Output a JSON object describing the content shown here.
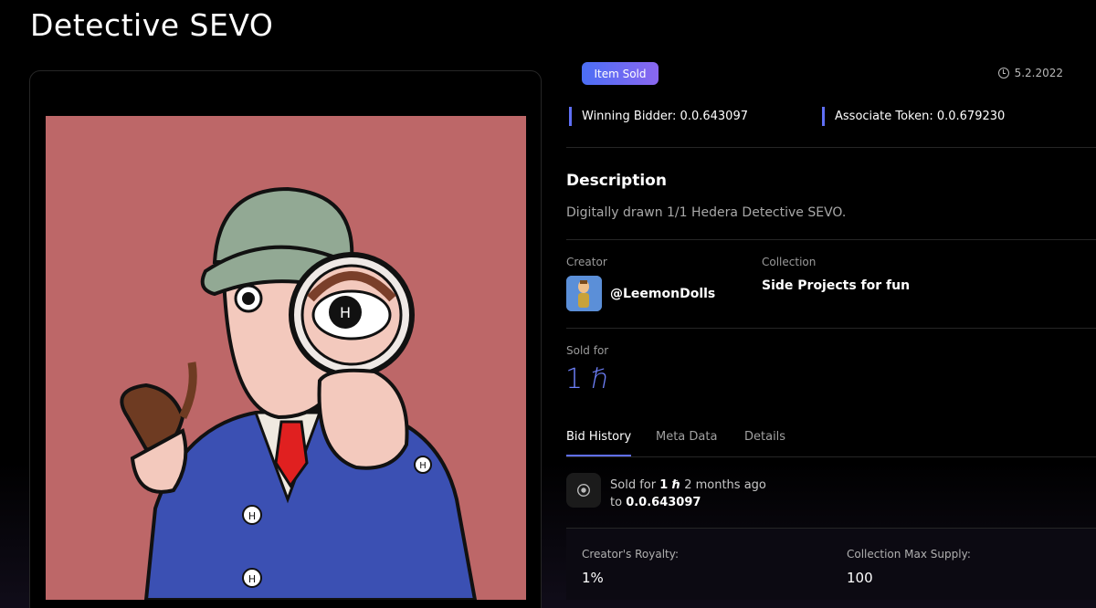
{
  "page": {
    "title": "Detective SEVO"
  },
  "status": {
    "badge": "Item Sold",
    "date": "5.2.2022",
    "date_icon": "clock-icon"
  },
  "meta": {
    "winning_bidder": "Winning Bidder: 0.0.643097",
    "associate_token": "Associate Token: 0.0.679230"
  },
  "description": {
    "heading": "Description",
    "text": "Digitally drawn 1/1 Hedera Detective SEVO."
  },
  "creator": {
    "label": "Creator",
    "name": "@LeemonDolls"
  },
  "collection": {
    "label": "Collection",
    "name": "Side Projects for fun"
  },
  "sale": {
    "label": "Sold for",
    "price": "1 ℏ"
  },
  "tabs": [
    {
      "label": "Bid History",
      "active": true
    },
    {
      "label": "Meta Data",
      "active": false
    },
    {
      "label": "Details",
      "active": false
    }
  ],
  "bid_history": [
    {
      "prefix": "Sold for",
      "amount": "1 ℏ",
      "when": "2 months ago",
      "to_prefix": "to",
      "to": "0.0.643097"
    }
  ],
  "stats": {
    "royalty_label": "Creator's Royalty:",
    "royalty_value": "1%",
    "max_supply_label": "Collection Max Supply:",
    "max_supply_value": "100"
  },
  "colors": {
    "accent": "#5f6ff5",
    "art_bg": "#bd6768",
    "price": "#6d7ff8"
  }
}
